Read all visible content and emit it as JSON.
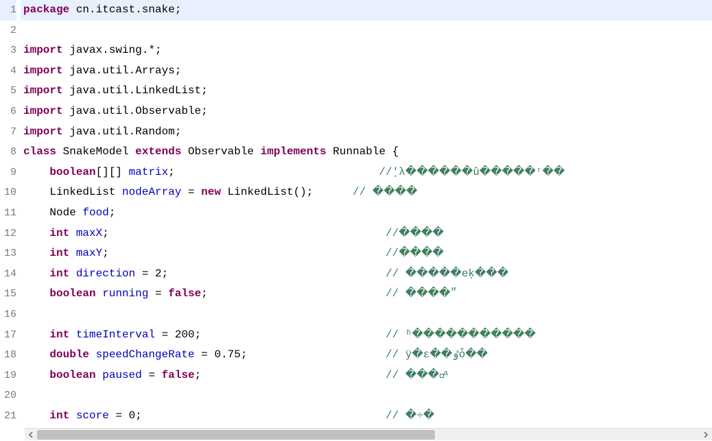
{
  "lines": [
    {
      "num": "1",
      "highlight": true,
      "segs": [
        {
          "t": "package ",
          "c": "kw"
        },
        {
          "t": "cn.itcast.snake;",
          "c": ""
        }
      ]
    },
    {
      "num": "2",
      "segs": []
    },
    {
      "num": "3",
      "fold": true,
      "segs": [
        {
          "t": "import ",
          "c": "kw"
        },
        {
          "t": "javax.swing.*;",
          "c": ""
        }
      ]
    },
    {
      "num": "4",
      "segs": [
        {
          "t": "import ",
          "c": "kw"
        },
        {
          "t": "java.util.Arrays;",
          "c": ""
        }
      ]
    },
    {
      "num": "5",
      "segs": [
        {
          "t": "import ",
          "c": "kw"
        },
        {
          "t": "java.util.LinkedList;",
          "c": ""
        }
      ]
    },
    {
      "num": "6",
      "segs": [
        {
          "t": "import ",
          "c": "kw"
        },
        {
          "t": "java.util.Observable;",
          "c": ""
        }
      ]
    },
    {
      "num": "7",
      "segs": [
        {
          "t": "import ",
          "c": "kw"
        },
        {
          "t": "java.util.Random;",
          "c": ""
        }
      ]
    },
    {
      "num": "8",
      "segs": [
        {
          "t": "class ",
          "c": "kw"
        },
        {
          "t": "SnakeModel ",
          "c": ""
        },
        {
          "t": "extends ",
          "c": "kw"
        },
        {
          "t": "Observable ",
          "c": ""
        },
        {
          "t": "implements ",
          "c": "kw"
        },
        {
          "t": "Runnable {",
          "c": ""
        }
      ]
    },
    {
      "num": "9",
      "segs": [
        {
          "t": "    ",
          "c": ""
        },
        {
          "t": "boolean",
          "c": "kw"
        },
        {
          "t": "[][] ",
          "c": ""
        },
        {
          "t": "matrix",
          "c": "field"
        },
        {
          "t": ";                               ",
          "c": ""
        },
        {
          "t": "//ָ'λ������û�����ʳ��",
          "c": "comment"
        }
      ]
    },
    {
      "num": "10",
      "segs": [
        {
          "t": "    LinkedList ",
          "c": ""
        },
        {
          "t": "nodeArray",
          "c": "field"
        },
        {
          "t": " = ",
          "c": ""
        },
        {
          "t": "new",
          "c": "kw"
        },
        {
          "t": " LinkedList();      ",
          "c": ""
        },
        {
          "t": "// ����",
          "c": "comment"
        }
      ]
    },
    {
      "num": "11",
      "segs": [
        {
          "t": "    Node ",
          "c": ""
        },
        {
          "t": "food",
          "c": "field"
        },
        {
          "t": ";",
          "c": ""
        }
      ]
    },
    {
      "num": "12",
      "segs": [
        {
          "t": "    ",
          "c": ""
        },
        {
          "t": "int",
          "c": "kw"
        },
        {
          "t": " ",
          "c": ""
        },
        {
          "t": "maxX",
          "c": "field"
        },
        {
          "t": ";                                          ",
          "c": ""
        },
        {
          "t": "//����",
          "c": "comment"
        }
      ]
    },
    {
      "num": "13",
      "segs": [
        {
          "t": "    ",
          "c": ""
        },
        {
          "t": "int",
          "c": "kw"
        },
        {
          "t": " ",
          "c": ""
        },
        {
          "t": "maxY",
          "c": "field"
        },
        {
          "t": ";                                          ",
          "c": ""
        },
        {
          "t": "//����",
          "c": "comment"
        }
      ]
    },
    {
      "num": "14",
      "segs": [
        {
          "t": "    ",
          "c": ""
        },
        {
          "t": "int",
          "c": "kw"
        },
        {
          "t": " ",
          "c": ""
        },
        {
          "t": "direction",
          "c": "field"
        },
        {
          "t": " = 2;                                 ",
          "c": ""
        },
        {
          "t": "// �����еķ���",
          "c": "comment"
        }
      ]
    },
    {
      "num": "15",
      "segs": [
        {
          "t": "    ",
          "c": ""
        },
        {
          "t": "boolean",
          "c": "kw"
        },
        {
          "t": " ",
          "c": ""
        },
        {
          "t": "running",
          "c": "field"
        },
        {
          "t": " = ",
          "c": ""
        },
        {
          "t": "false",
          "c": "kw"
        },
        {
          "t": ";                           ",
          "c": ""
        },
        {
          "t": "// ����״",
          "c": "comment"
        }
      ]
    },
    {
      "num": "16",
      "segs": []
    },
    {
      "num": "17",
      "segs": [
        {
          "t": "    ",
          "c": ""
        },
        {
          "t": "int",
          "c": "kw"
        },
        {
          "t": " ",
          "c": ""
        },
        {
          "t": "timeInterval",
          "c": "field"
        },
        {
          "t": " = 200;                            ",
          "c": ""
        },
        {
          "t": "// ʱ�����������",
          "c": "comment"
        }
      ]
    },
    {
      "num": "18",
      "segs": [
        {
          "t": "    ",
          "c": ""
        },
        {
          "t": "double",
          "c": "kw"
        },
        {
          "t": " ",
          "c": ""
        },
        {
          "t": "speedChangeRate",
          "c": "field"
        },
        {
          "t": " = 0.75;                     ",
          "c": ""
        },
        {
          "t": "// ÿ�ε��ٶȱ��",
          "c": "comment"
        }
      ]
    },
    {
      "num": "19",
      "segs": [
        {
          "t": "    ",
          "c": ""
        },
        {
          "t": "boolean",
          "c": "kw"
        },
        {
          "t": " ",
          "c": ""
        },
        {
          "t": "paused",
          "c": "field"
        },
        {
          "t": " = ",
          "c": ""
        },
        {
          "t": "false",
          "c": "kw"
        },
        {
          "t": ";                            ",
          "c": ""
        },
        {
          "t": "// ����ͣ",
          "c": "comment"
        }
      ]
    },
    {
      "num": "20",
      "segs": []
    },
    {
      "num": "21",
      "segs": [
        {
          "t": "    ",
          "c": ""
        },
        {
          "t": "int",
          "c": "kw"
        },
        {
          "t": " ",
          "c": ""
        },
        {
          "t": "score",
          "c": "field"
        },
        {
          "t": " = 0;                                     ",
          "c": ""
        },
        {
          "t": "// �÷�",
          "c": "comment"
        }
      ]
    }
  ]
}
